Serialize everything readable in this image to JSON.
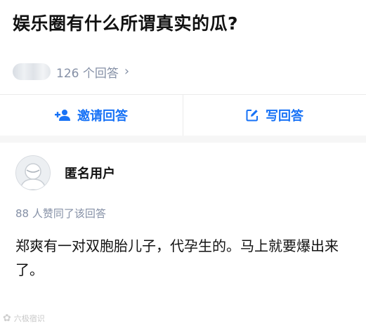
{
  "question": {
    "title": "娱乐圈有什么所谓真实的瓜?",
    "answer_count": "126 个回答"
  },
  "actions": {
    "invite_label": "邀请回答",
    "write_label": "写回答"
  },
  "answer": {
    "author_name": "匿名用户",
    "vote_text": "88 人赞同了该回答",
    "content": "郑爽有一对双胞胎儿子，代孕生的。马上就要爆出来了。"
  },
  "watermark": {
    "text": "六极宿识"
  },
  "colors": {
    "accent": "#1772f6",
    "meta": "#8590a6",
    "title": "#121212",
    "divider": "#ebebeb"
  },
  "icons": {
    "invite": "add-person-icon",
    "write": "edit-icon",
    "chevron": "chevron-right-icon",
    "avatar": "anonymous-avatar-icon"
  }
}
